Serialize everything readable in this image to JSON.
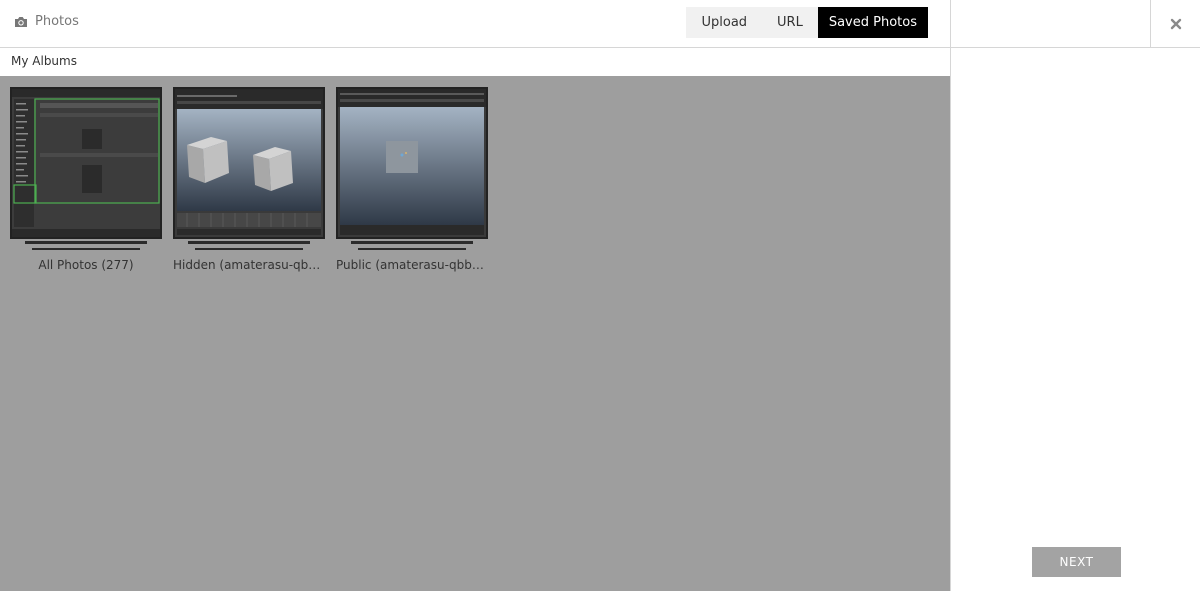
{
  "header": {
    "title": "Photos",
    "title_icon": "camera-icon",
    "tabs": [
      {
        "label": "Upload",
        "active": false
      },
      {
        "label": "URL",
        "active": false
      },
      {
        "label": "Saved Photos",
        "active": true
      }
    ]
  },
  "subheader": {
    "label": "My Albums"
  },
  "albums": [
    {
      "name": "All Photos (277)"
    },
    {
      "name": "Hidden (amaterasu-qbb) ..."
    },
    {
      "name": "Public (amaterasu-qbb) (..."
    }
  ],
  "sidebar": {
    "close_icon": "close-icon",
    "next_label": "NEXT"
  },
  "colors": {
    "gallery_bg": "#9e9e9e",
    "active_tab_bg": "#000000",
    "next_button_bg": "#a3a3a3"
  }
}
